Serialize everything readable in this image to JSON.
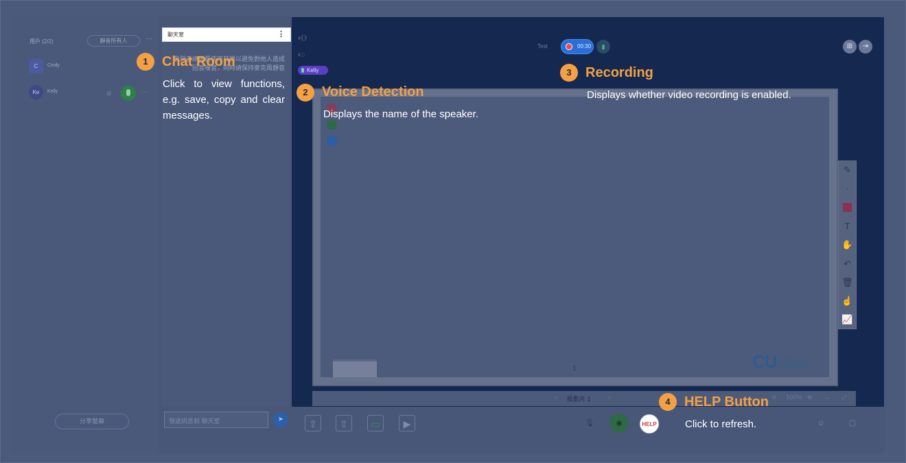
{
  "users_panel": {
    "header": "用戶 (2/2)",
    "mute_all_label": "靜音所有人",
    "more_label": "···",
    "users": [
      {
        "avatar": "C",
        "name": "Cindy"
      },
      {
        "avatar": "Ke",
        "name": "Kelly"
      }
    ],
    "share_label": "分享螢幕"
  },
  "chat_panel": {
    "title": "聊天室",
    "menu_label": "⋮",
    "message": "參與者請儘量使用耳機以避免對他人造成回音噪音，同時請保持麥克風靜音",
    "input_placeholder": "發送訊息到 聊天室",
    "send_label": "➤"
  },
  "stage": {
    "speaker_name": "Kelly",
    "meeting_label": "Test",
    "recording_time": "00:30",
    "page_number": "1",
    "logo_main": "CU",
    "logo_sub": "class",
    "slide_label": "投影片 1",
    "zoom_label": "100%"
  },
  "annotations": [
    {
      "number": "1",
      "title": "Chat Room",
      "desc": "Click to view functions, e.g. save, copy and clear messages."
    },
    {
      "number": "2",
      "title": "Voice Detection",
      "desc": "Displays the name of the speaker."
    },
    {
      "number": "3",
      "title": "Recording",
      "desc": "Displays whether video recording is enabled."
    },
    {
      "number": "4",
      "title": "HELP Button",
      "desc": "Click to refresh."
    }
  ],
  "help_label": "HELP",
  "colors": {
    "overlay": "#4a5878",
    "stage": "#15284f",
    "accent": "#f5a043",
    "recording": "#2a6fd6",
    "speaker_pill": "#5a3fc2"
  }
}
